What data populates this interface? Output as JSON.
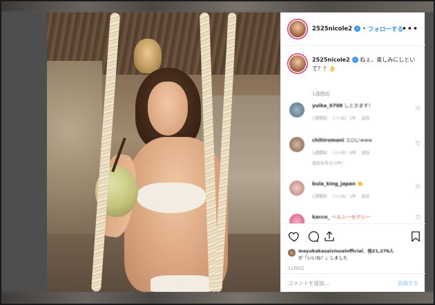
{
  "post": {
    "username": "2525nicole2",
    "follow_label": "フォローする",
    "separator": "•",
    "more_label": "•••",
    "caption_text": "ねぇ、楽しみにしといて？？👌",
    "caption_time": "1週間前"
  },
  "comments": [
    {
      "username": "yuika_0708",
      "text": "しときます！",
      "meta": [
        "1週間前",
        "いいね！1件",
        "返信"
      ]
    },
    {
      "username": "chihiromani",
      "text": "エロいwww",
      "meta": [
        "1週間前",
        "いいね！9件",
        "返信"
      ],
      "replies": "返信を見る(1件)"
    },
    {
      "username": "bula_king_japan",
      "text": "👏",
      "meta": [
        "1週間前",
        "いいね！1件",
        "返信"
      ]
    },
    {
      "username": "kacco_",
      "text": "ヘルシーセクシー",
      "meta": []
    }
  ],
  "likes": {
    "liker": "mayukakasaivisualofficial",
    "others_count": "他21,276人",
    "suffix": "が「いいね！」しました"
  },
  "post_date": "11月6日",
  "comment_input": {
    "placeholder": "コメントを追加...",
    "post_label": "投稿する"
  },
  "icons": {
    "like": "heart-icon",
    "comment": "comment-icon",
    "share": "share-icon",
    "save": "bookmark-icon",
    "verified": "verified-badge-icon"
  },
  "colors": {
    "accent": "#3897f0",
    "text": "#262626",
    "muted": "#999999",
    "post_button": "#b3dbff"
  }
}
